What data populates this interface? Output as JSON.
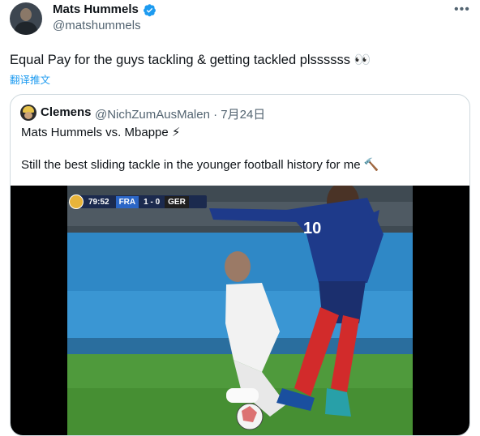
{
  "author": {
    "name": "Mats Hummels",
    "handle": "@matshummels"
  },
  "tweet": {
    "text": "Equal Pay for the guys tackling & getting tackled plssssss 👀",
    "translate_label": "翻译推文"
  },
  "quoted": {
    "name": "Clemens",
    "handle_time": "@NichZumAusMalen · 7月24日",
    "line1": "Mats Hummels vs. Mbappe ⚡",
    "line2": "Still the best sliding tackle in the younger football history for me 🔨"
  },
  "scoreboard": {
    "time": "79:52",
    "home": "FRA",
    "score": "1 - 0",
    "away": "GER"
  },
  "jersey_number": "10",
  "colors": {
    "link": "#1d9bf0",
    "verified": "#1d9bf0",
    "muted": "#536471",
    "border": "#cfd9de"
  },
  "icons": [
    "verified-badge-icon",
    "more-options-icon"
  ]
}
